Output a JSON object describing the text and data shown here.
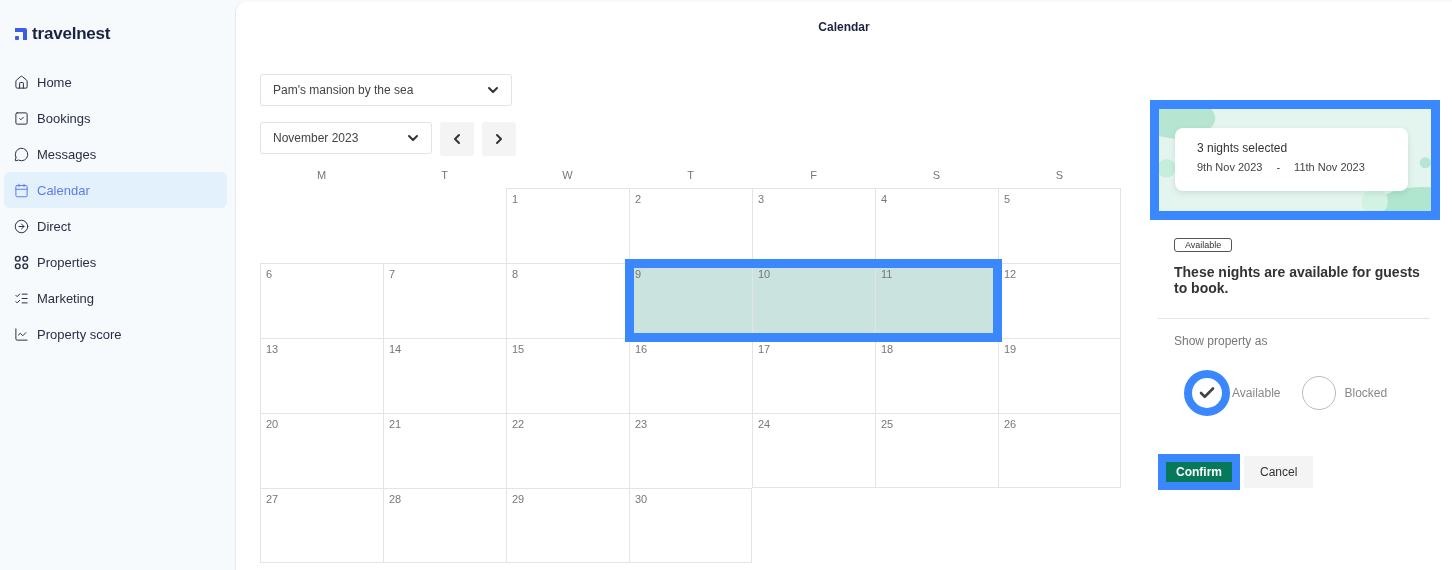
{
  "brand": {
    "name": "travelnest"
  },
  "sidebar": {
    "items": [
      {
        "label": "Home",
        "selected": false
      },
      {
        "label": "Bookings",
        "selected": false
      },
      {
        "label": "Messages",
        "selected": false
      },
      {
        "label": "Calendar",
        "selected": true
      },
      {
        "label": "Direct",
        "selected": false
      },
      {
        "label": "Properties",
        "selected": false
      },
      {
        "label": "Marketing",
        "selected": false
      },
      {
        "label": "Property score",
        "selected": false
      }
    ]
  },
  "page": {
    "title": "Calendar"
  },
  "property_select": {
    "value": "Pam's mansion by the sea"
  },
  "month_select": {
    "value": "November 2023"
  },
  "weekdays": [
    "M",
    "T",
    "W",
    "T",
    "F",
    "S",
    "S"
  ],
  "weeks": [
    [
      {
        "day": "1",
        "selected": false
      },
      {
        "day": "2",
        "selected": false
      },
      {
        "day": "3",
        "selected": false
      },
      {
        "day": "4",
        "selected": false
      },
      {
        "day": "5",
        "selected": false
      }
    ],
    [
      {
        "day": "6",
        "selected": false
      },
      {
        "day": "7",
        "selected": false
      },
      {
        "day": "8",
        "selected": false
      },
      {
        "day": "9",
        "selected": true
      },
      {
        "day": "10",
        "selected": true
      },
      {
        "day": "11",
        "selected": true
      },
      {
        "day": "12",
        "selected": false
      }
    ],
    [
      {
        "day": "13",
        "selected": false
      },
      {
        "day": "14",
        "selected": false
      },
      {
        "day": "15",
        "selected": false
      },
      {
        "day": "16",
        "selected": false
      },
      {
        "day": "17",
        "selected": false
      },
      {
        "day": "18",
        "selected": false
      },
      {
        "day": "19",
        "selected": false
      }
    ],
    [
      {
        "day": "20",
        "selected": false
      },
      {
        "day": "21",
        "selected": false
      },
      {
        "day": "22",
        "selected": false
      },
      {
        "day": "23",
        "selected": false
      },
      {
        "day": "24",
        "selected": false
      },
      {
        "day": "25",
        "selected": false
      },
      {
        "day": "26",
        "selected": false
      }
    ],
    [
      {
        "day": "27",
        "selected": false
      },
      {
        "day": "28",
        "selected": false
      },
      {
        "day": "29",
        "selected": false
      },
      {
        "day": "30",
        "selected": false
      }
    ]
  ],
  "selection_highlighted": true,
  "summary": {
    "highlighted": true,
    "title": "3 nights selected",
    "from": "9th Nov 2023",
    "separator": "-",
    "to": "11th Nov 2023"
  },
  "status_badge": "Available",
  "status_text": "These nights are available for guests to book.",
  "show_as": {
    "label": "Show property as",
    "options": [
      {
        "label": "Available",
        "selected": true
      },
      {
        "label": "Blocked",
        "selected": false
      }
    ]
  },
  "buttons": [
    {
      "label": "Confirm",
      "kind": "primary",
      "highlighted": true
    },
    {
      "label": "Cancel",
      "kind": "secondary",
      "highlighted": false
    }
  ]
}
